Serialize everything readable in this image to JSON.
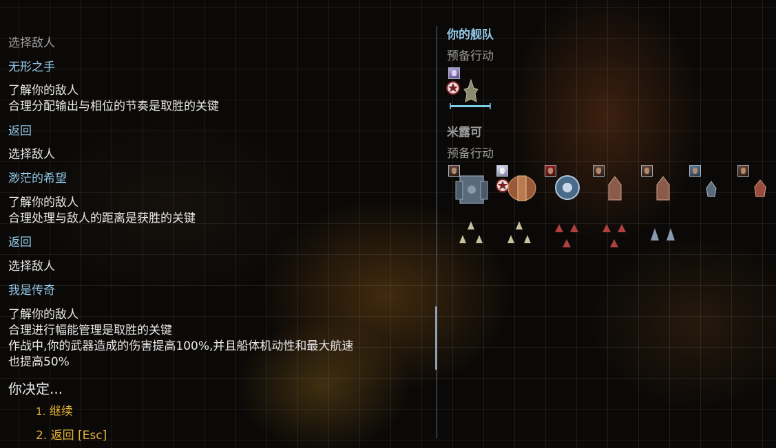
{
  "dialog": {
    "lines": [
      {
        "text": "选择敌人",
        "style": "gray"
      },
      {
        "text": "无形之手",
        "style": "blue"
      },
      {
        "text": "了解你的敌人",
        "style": "white"
      },
      {
        "text": "合理分配输出与相位的节奏是取胜的关键",
        "style": "white"
      },
      {
        "text": "返回",
        "style": "blue"
      },
      {
        "text": "选择敌人",
        "style": "white"
      },
      {
        "text": "渺茫的希望",
        "style": "blue"
      },
      {
        "text": "了解你的敌人",
        "style": "white"
      },
      {
        "text": "合理处理与敌人的距离是获胜的关键",
        "style": "white"
      },
      {
        "text": "返回",
        "style": "blue"
      },
      {
        "text": "选择敌人",
        "style": "white"
      },
      {
        "text": "我是传奇",
        "style": "blue"
      },
      {
        "text": "了解你的敌人",
        "style": "white"
      },
      {
        "text": "合理进行幅能管理是取胜的关键",
        "style": "white"
      },
      {
        "text": "作战中,你的武器造成的伤害提高100%,并且船体机动性和最大航速",
        "style": "white"
      },
      {
        "text": "也提高50%",
        "style": "white"
      }
    ],
    "prompt": "你决定...",
    "options": [
      {
        "number": "1.",
        "label": "继续"
      },
      {
        "number": "2.",
        "label": "返回 [Esc]"
      }
    ]
  },
  "player_fleet": {
    "title": "你的舰队",
    "stance": "预备行动"
  },
  "enemy_fleet": {
    "title": "米露可",
    "stance": "预备行动"
  },
  "colors": {
    "accent_blue": "#93c8e8",
    "option_yellow": "#e2b23a",
    "text_white": "#e8e8e8",
    "text_gray": "#9b9b9b"
  },
  "icons": [
    "officer-portrait-icon",
    "commander-star-icon",
    "ship-sprite-icon"
  ]
}
